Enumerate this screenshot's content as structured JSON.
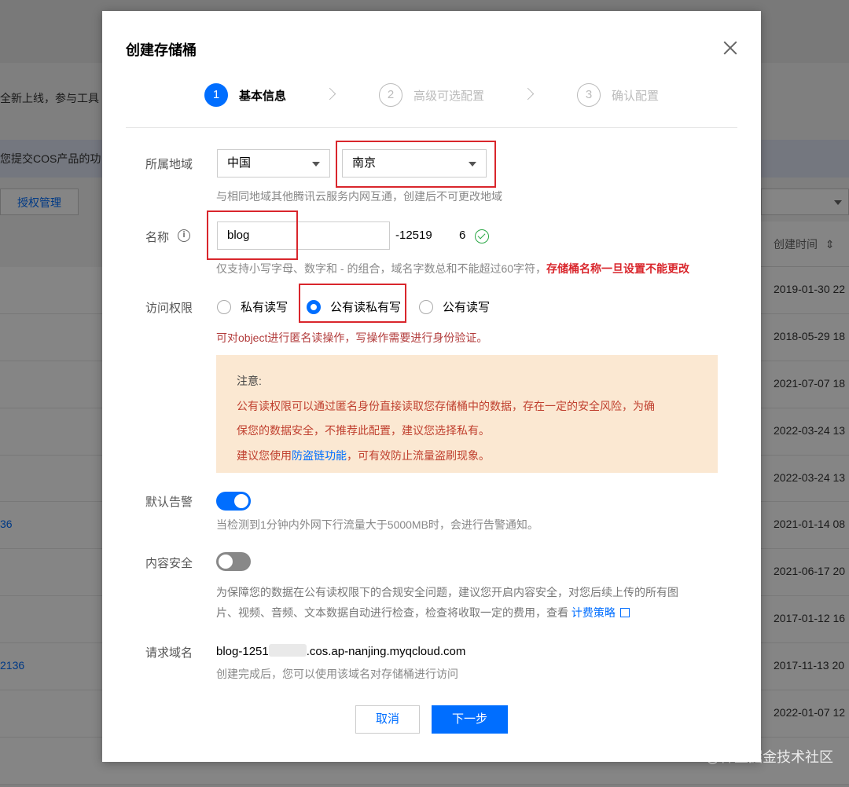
{
  "background": {
    "notice_text": "全新上线，参与工具",
    "banner_text": "您提交COS产品的功",
    "auth_button": "授权管理",
    "col_header": "创建时间",
    "sort_icon": "sort-icon",
    "rows": [
      {
        "date": "2019-01-30 22",
        "link": ""
      },
      {
        "date": "2018-05-29 18",
        "link": ""
      },
      {
        "date": "2021-07-07 18",
        "link": ""
      },
      {
        "date": "2022-03-24 13",
        "link": ""
      },
      {
        "date": "2022-03-24 13",
        "link": ""
      },
      {
        "date": "2021-01-14 08",
        "link": "36"
      },
      {
        "date": "2021-06-17 20",
        "link": ""
      },
      {
        "date": "2017-01-12 16",
        "link": ""
      },
      {
        "date": "2017-11-13 20",
        "link": "2136"
      },
      {
        "date": "2022-01-07 12",
        "link": ""
      },
      {
        "date": "",
        "link": ""
      }
    ],
    "watermark": "@稀土掘金技术社区"
  },
  "modal": {
    "title": "创建存储桶",
    "close_icon": "close-icon",
    "steps": [
      {
        "num": "1",
        "label": "基本信息",
        "active": true
      },
      {
        "num": "2",
        "label": "高级可选配置",
        "active": false
      },
      {
        "num": "3",
        "label": "确认配置",
        "active": false
      }
    ],
    "region": {
      "label": "所属地域",
      "country": "中国",
      "city": "南京",
      "hint": "与相同地域其他腾讯云服务内网互通，创建后不可更改地域"
    },
    "name": {
      "label": "名称",
      "info_icon": "info-icon",
      "value": "blog",
      "suffix_a": "-12519",
      "suffix_b": "6",
      "check_icon": "check-circle-icon",
      "hint": "仅支持小写字母、数字和 - 的组合，域名字数总和不能超过60字符，",
      "hint_warning": "存储桶名称一旦设置不能更改"
    },
    "access": {
      "label": "访问权限",
      "options": [
        "私有读写",
        "公有读私有写",
        "公有读写"
      ],
      "selected": "公有读私有写",
      "desc": "可对object进行匿名读操作，写操作需要进行身份验证。"
    },
    "notice": {
      "title": "注意:",
      "line1": "公有读权限可以通过匿名身份直接读取您存储桶中的数据，存在一定的安全风险，为确",
      "line2": "保您的数据安全，不推荐此配置，建议您选择私有。",
      "line3_prefix": "建议您使用",
      "line3_link": "防盗链功能",
      "line3_suffix": "，可有效防止流量盗刷现象。"
    },
    "alarm": {
      "label": "默认告警",
      "on": true,
      "hint": "当检测到1分钟内外网下行流量大于5000MB时，会进行告警通知。"
    },
    "content_security": {
      "label": "内容安全",
      "on": false,
      "line1": "为保障您的数据在公有读权限下的合规安全问题，建议您开启内容安全，对您后续上传的所有图",
      "line2_prefix": "片、视频、音频、文本数据自动进行检查，检查将收取一定的费用，查看 ",
      "line2_link": "计费策略",
      "ext_icon": "external-link-icon"
    },
    "domain": {
      "label": "请求域名",
      "prefix": "blog-1251",
      "suffix": ".cos.ap-nanjing.myqcloud.com",
      "hint": "创建完成后，您可以使用该域名对存储桶进行访问"
    },
    "buttons": {
      "cancel": "取消",
      "next": "下一步"
    },
    "accent_color": "#006eff",
    "highlight_color": "#d9262c"
  }
}
